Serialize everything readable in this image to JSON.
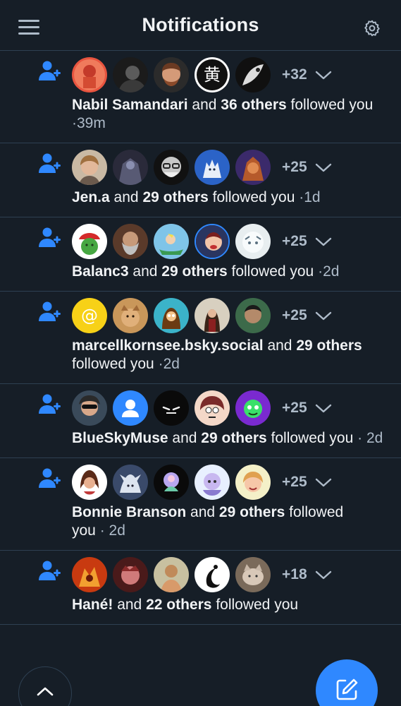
{
  "header": {
    "title": "Notifications"
  },
  "notifications": [
    {
      "name": "Nabil Samandari",
      "connector": "and",
      "others": "36 others",
      "action": "followed you",
      "sep": "·",
      "time": "39m",
      "extra": "+32"
    },
    {
      "name": "Jen.a",
      "connector": "and",
      "others": "29 others",
      "action": "followed you",
      "sep": "·",
      "time": "1d",
      "extra": "+25"
    },
    {
      "name": "Balanc3",
      "connector": "and",
      "others": "29 others",
      "action": "followed you",
      "sep": "·",
      "time": "2d",
      "extra": "+25"
    },
    {
      "name": "marcellkornsee.bsky.social",
      "connector": "and",
      "others": "29 others",
      "action": "followed you",
      "sep": "·",
      "time": "2d",
      "extra": "+25"
    },
    {
      "name": "BlueSkyMuse",
      "connector": "and",
      "others": "29 others",
      "action": "followed you",
      "sep": "·",
      "time": "2d",
      "extra": "+25"
    },
    {
      "name": "Bonnie Branson",
      "connector": "and",
      "others": "29 others",
      "action": "followed",
      "action2": "you",
      "sep": "·",
      "time": "2d",
      "extra": "+25"
    },
    {
      "name": "Hané!",
      "connector": "and",
      "others": "22 others",
      "action": "followed you",
      "extra": "+18"
    }
  ],
  "icons": {
    "menu": "menu-icon",
    "settings": "gear-icon",
    "follow": "person-plus-icon",
    "expand": "chevron-down-icon",
    "scroll_top": "chevron-up-icon",
    "compose": "compose-icon"
  },
  "colors": {
    "background": "#161e27",
    "accent": "#2f88ff",
    "muted": "#aebbc9",
    "divider": "#2e4052"
  }
}
